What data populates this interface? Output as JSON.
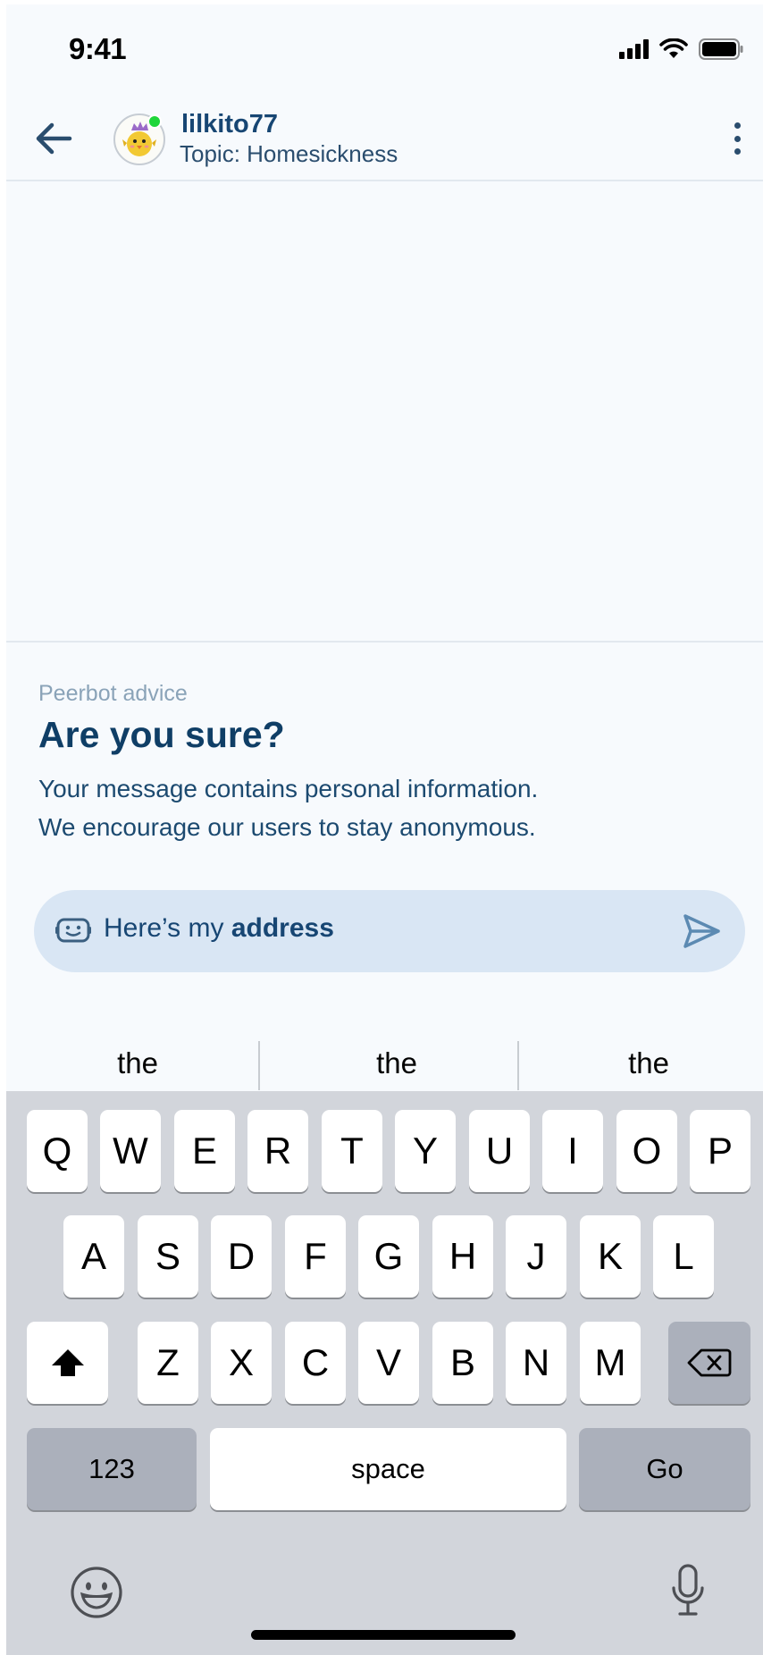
{
  "status_bar": {
    "time": "9:41"
  },
  "header": {
    "username": "lilkito77",
    "topic": "Topic: Homesickness"
  },
  "advice": {
    "label": "Peerbot advice",
    "title": "Are you sure?",
    "body_line1": "Your message contains personal information.",
    "body_line2": "We encourage our users to stay anonymous."
  },
  "message_input": {
    "text_prefix": "Here’s my ",
    "text_bold": "address"
  },
  "suggestions": [
    "the",
    "the",
    "the"
  ],
  "keyboard": {
    "row1": [
      "Q",
      "W",
      "E",
      "R",
      "T",
      "Y",
      "U",
      "I",
      "O",
      "P"
    ],
    "row2": [
      "A",
      "S",
      "D",
      "F",
      "G",
      "H",
      "J",
      "K",
      "L"
    ],
    "row3": [
      "Z",
      "X",
      "C",
      "V",
      "B",
      "N",
      "M"
    ],
    "numbers_label": "123",
    "space_label": "space",
    "go_label": "Go"
  },
  "colors": {
    "accent": "#174673",
    "online": "#1fd63a",
    "input_bg": "#d9e6f4"
  }
}
